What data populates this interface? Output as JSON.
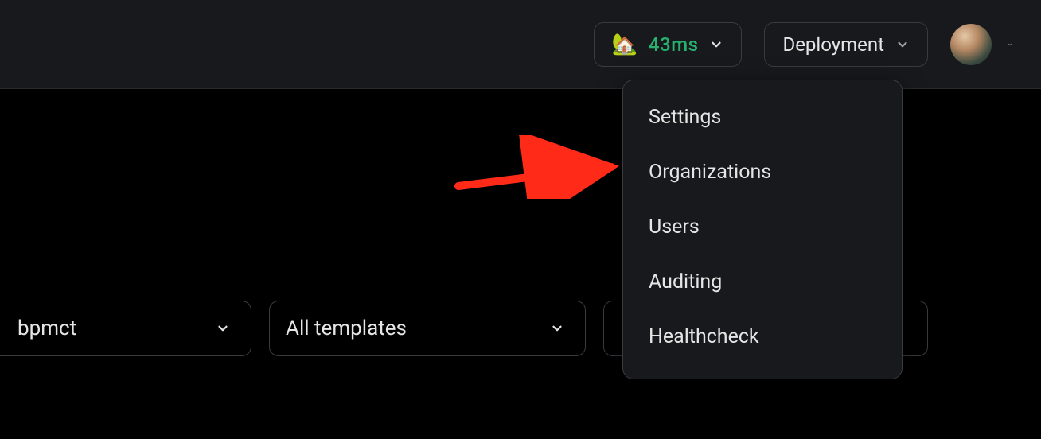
{
  "topbar": {
    "latency": {
      "emoji": "🏡",
      "value": "43ms"
    },
    "deployment_label": "Deployment"
  },
  "deployment_menu": {
    "items": [
      {
        "label": "Settings"
      },
      {
        "label": "Organizations"
      },
      {
        "label": "Users"
      },
      {
        "label": "Auditing"
      },
      {
        "label": "Healthcheck"
      }
    ]
  },
  "filters": {
    "user_label": "bpmct",
    "templates_label": "All templates"
  }
}
